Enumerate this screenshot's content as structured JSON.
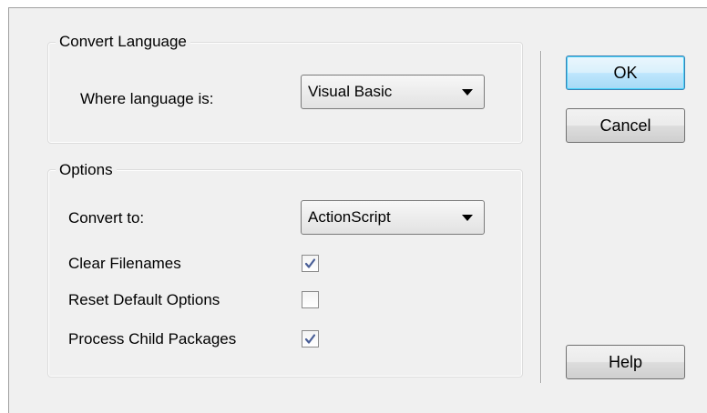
{
  "convert_language": {
    "title": "Convert Language",
    "where_label": "Where language is:",
    "where_value": "Visual Basic"
  },
  "options": {
    "title": "Options",
    "convert_to_label": "Convert to:",
    "convert_to_value": "ActionScript",
    "clear_filenames_label": "Clear Filenames",
    "clear_filenames_checked": true,
    "reset_default_label": "Reset Default Options",
    "reset_default_checked": false,
    "process_child_label": "Process Child Packages",
    "process_child_checked": true
  },
  "buttons": {
    "ok": "OK",
    "cancel": "Cancel",
    "help": "Help"
  },
  "icons": {
    "combo_arrow": "chevron-down-icon",
    "check": "checkmark-icon"
  },
  "colors": {
    "dialog_background": "#f0f0f0",
    "default_button_border": "#3c7fb1",
    "check_color": "#4a5f97"
  }
}
